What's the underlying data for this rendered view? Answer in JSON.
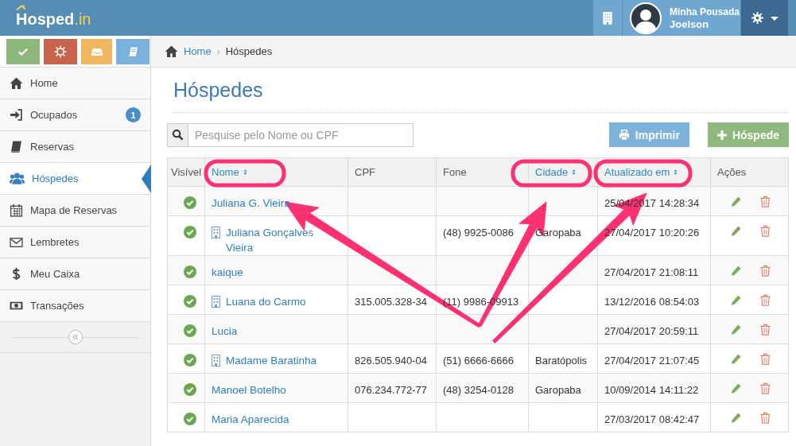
{
  "header": {
    "logo": "Hosped",
    "logo_suffix": ".in",
    "account": "Minha Pousada",
    "user": "Joelson"
  },
  "quick_buttons": [
    {
      "color": "#8db87c"
    },
    {
      "color": "#c7634a"
    },
    {
      "color": "#f1b65e"
    },
    {
      "color": "#79b0dc"
    }
  ],
  "sidebar": {
    "items": [
      {
        "label": "Home",
        "selected": false
      },
      {
        "label": "Ocupados",
        "badge": "1",
        "selected": false
      },
      {
        "label": "Reservas",
        "selected": false
      },
      {
        "label": "Hóspedes",
        "selected": true
      },
      {
        "label": "Mapa de Reservas",
        "selected": false
      },
      {
        "label": "Lembretes",
        "selected": false
      },
      {
        "label": "Meu Caixa",
        "selected": false
      },
      {
        "label": "Transações",
        "selected": false
      }
    ]
  },
  "breadcrumb": {
    "home": "Home",
    "separator": "›",
    "current": "Hóspedes"
  },
  "title": "Hóspedes",
  "search": {
    "placeholder": "Pesquise pelo Nome ou CPF"
  },
  "buttons": {
    "print": "Imprimir",
    "add": "Hóspede"
  },
  "table": {
    "columns": [
      {
        "label": "Visível",
        "sortable": false
      },
      {
        "label": "Nome",
        "sortable": true
      },
      {
        "label": "CPF",
        "sortable": false
      },
      {
        "label": "Fone",
        "sortable": false
      },
      {
        "label": "Cidade",
        "sortable": true
      },
      {
        "label": "Atualizado em",
        "sortable": true
      },
      {
        "label": "Ações",
        "sortable": false
      }
    ],
    "rows": [
      {
        "visible": true,
        "building": false,
        "name": "Juliana G. Vieira",
        "cpf": "",
        "fone": "",
        "cidade": "",
        "updated": "25/04/2017 14:28:34"
      },
      {
        "visible": true,
        "building": true,
        "name": "Juliana Gonçalves Vieira",
        "cpf": "",
        "fone": "(48) 9925-0086",
        "cidade": "Garopaba",
        "updated": "27/04/2017 10:20:26"
      },
      {
        "visible": true,
        "building": false,
        "name": "kaique",
        "cpf": "",
        "fone": "",
        "cidade": "",
        "updated": "27/04/2017 21:08:11"
      },
      {
        "visible": true,
        "building": true,
        "name": "Luana do Carmo",
        "cpf": "315.005.328-34",
        "fone": "(11) 9986-09913",
        "cidade": "",
        "updated": "13/12/2016 08:54:03"
      },
      {
        "visible": true,
        "building": false,
        "name": "Lucia",
        "cpf": "",
        "fone": "",
        "cidade": "",
        "updated": "27/04/2017 20:59:11"
      },
      {
        "visible": true,
        "building": true,
        "name": "Madame Baratinha",
        "cpf": "826.505.940-04",
        "fone": "(51) 6666-6666",
        "cidade": "Baratópolis",
        "updated": "27/04/2017 21:07:45"
      },
      {
        "visible": true,
        "building": false,
        "name": "Manoel Botelho",
        "cpf": "076.234.772-77",
        "fone": "(48) 3254-0128",
        "cidade": "Garopaba",
        "updated": "10/09/2014 14:11:22"
      },
      {
        "visible": true,
        "building": false,
        "name": "Maria Aparecida",
        "cpf": "",
        "fone": "",
        "cidade": "",
        "updated": "27/03/2017 08:42:47"
      }
    ]
  }
}
